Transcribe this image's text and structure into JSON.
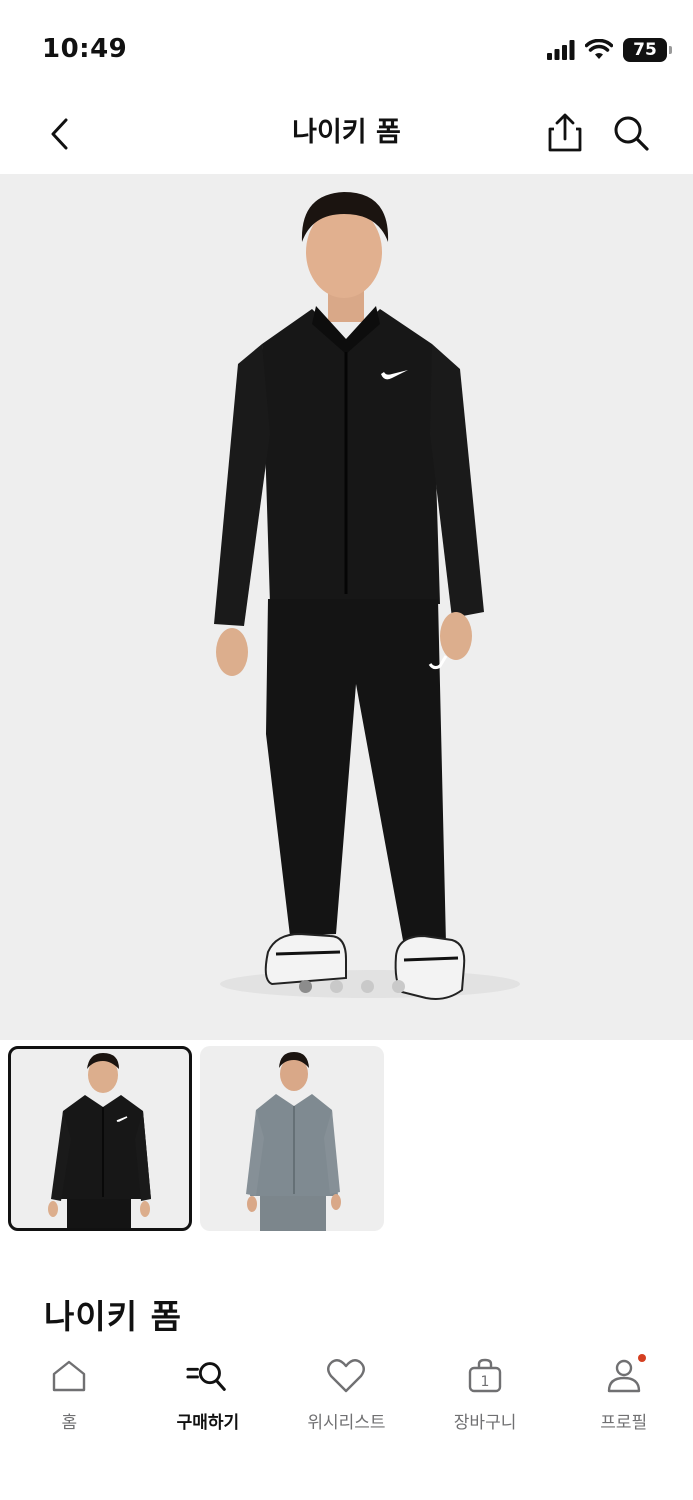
{
  "status_bar": {
    "time": "10:49",
    "battery": "75"
  },
  "header": {
    "title": "나이키 폼"
  },
  "product": {
    "title": "나이키 폼",
    "image_count": 4,
    "active_image_index": 0,
    "thumbnails": [
      {
        "color": "black",
        "selected": true
      },
      {
        "color": "grey",
        "selected": false
      }
    ]
  },
  "bottom_nav": {
    "items": [
      {
        "label": "홈",
        "icon": "home-icon",
        "active": false
      },
      {
        "label": "구매하기",
        "icon": "shop-search-icon",
        "active": true
      },
      {
        "label": "위시리스트",
        "icon": "heart-icon",
        "active": false
      },
      {
        "label": "장바구니",
        "icon": "bag-icon",
        "active": false,
        "badge": "1"
      },
      {
        "label": "프로필",
        "icon": "profile-icon",
        "active": false,
        "notification": true
      }
    ]
  },
  "colors": {
    "text": "#111111",
    "muted": "#707072",
    "image_bg": "#eeeeee",
    "notification": "#d43f21"
  }
}
